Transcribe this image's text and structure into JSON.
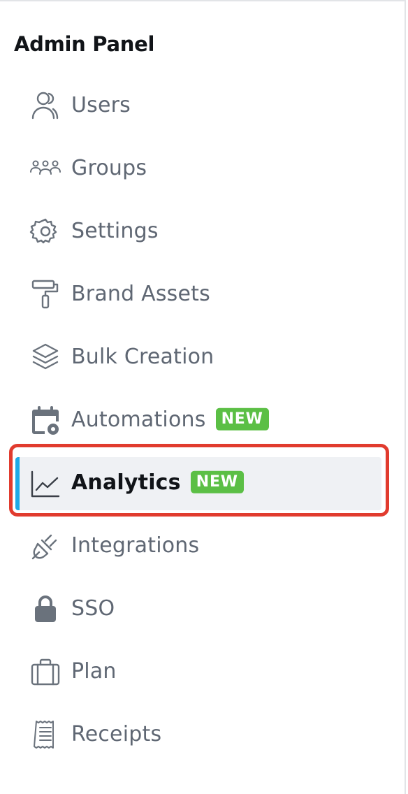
{
  "panel": {
    "title": "Admin Panel"
  },
  "menu": {
    "items": [
      {
        "label": "Users",
        "icon": "users-icon"
      },
      {
        "label": "Groups",
        "icon": "groups-icon"
      },
      {
        "label": "Settings",
        "icon": "gear-icon"
      },
      {
        "label": "Brand Assets",
        "icon": "paint-roller-icon"
      },
      {
        "label": "Bulk Creation",
        "icon": "layers-icon"
      },
      {
        "label": "Automations",
        "icon": "calendar-gear-icon",
        "badge": "NEW"
      },
      {
        "label": "Analytics",
        "icon": "line-chart-icon",
        "badge": "NEW",
        "active": true
      },
      {
        "label": "Integrations",
        "icon": "plug-icon"
      },
      {
        "label": "SSO",
        "icon": "lock-icon"
      },
      {
        "label": "Plan",
        "icon": "briefcase-icon"
      },
      {
        "label": "Receipts",
        "icon": "receipt-icon"
      }
    ]
  },
  "colors": {
    "accent": "#1eaae7",
    "badge": "#5bbf45",
    "highlight": "#eff1f4",
    "focus_ring": "#e13b2e"
  }
}
